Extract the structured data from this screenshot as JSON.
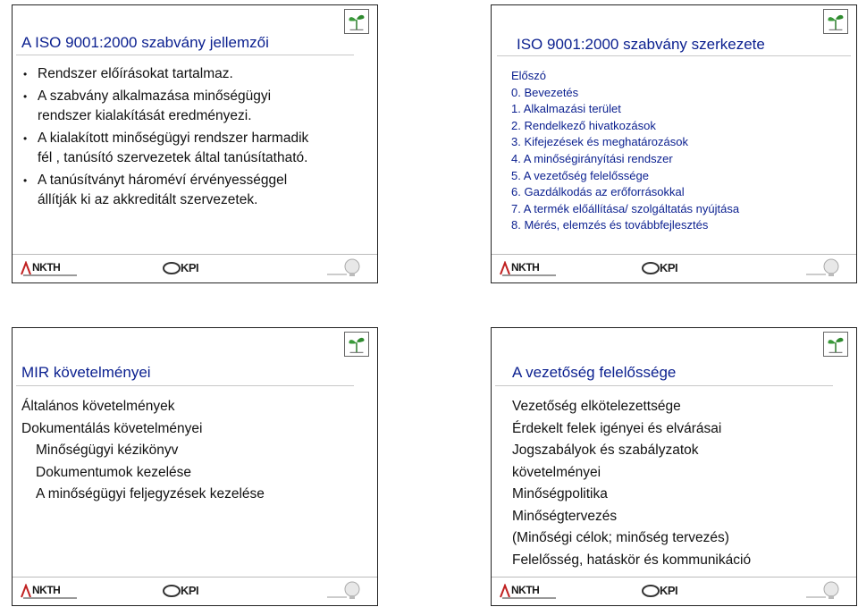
{
  "slides": [
    {
      "title": "A ISO 9001:2000 szabvány jellemzői",
      "items": [
        "Rendszer előírásokat tartalmaz.",
        "A szabvány alkalmazása minőségügyi rendszer kialakítását eredményezi.",
        "A kialakított minőségügyi rendszer harmadik fél , tanúsító szervezetek által tanúsítatható.",
        "A tanúsítványt hároméví érvényességgel állítják ki az akkreditált szervezetek."
      ]
    },
    {
      "title": "ISO 9001:2000 szabvány szerkezete",
      "items": [
        "Előszó",
        "0. Bevezetés",
        "1.  Alkalmazási terület",
        "2.  Rendelkező hivatkozások",
        "3.  Kifejezések és meghatározások",
        "4.  A minőségirányítási rendszer",
        "5.  A vezetőség felelőssége",
        "6.  Gazdálkodás az erőforrásokkal",
        "7.  A termék előállítása/ szolgáltatás nyújtása",
        "8.  Mérés, elemzés és továbbfejlesztés"
      ]
    },
    {
      "title": "MIR követelményei",
      "items": [
        {
          "text": "Általános követelmények",
          "indent": false
        },
        {
          "text": "Dokumentálás követelményei",
          "indent": false
        },
        {
          "text": "Minőségügyi kézikönyv",
          "indent": true
        },
        {
          "text": "Dokumentumok kezelése",
          "indent": true
        },
        {
          "text": "A minőségügyi feljegyzések kezelése",
          "indent": true
        }
      ]
    },
    {
      "title": "A vezetőség felelőssége",
      "items": [
        "Vezetőség elkötelezettsége",
        "Érdekelt felek igényei és elvárásai",
        "Jogszabályok és szabályzatok",
        "követelményei",
        "Minőségpolitika",
        "Minőségtervezés",
        "(Minőségi célok; minőség tervezés)",
        "Felelősség, hatáskör és kommunikáció"
      ]
    }
  ],
  "footer": {
    "nkth_label": "NKTH",
    "kpi_label": "KPI"
  },
  "colors": {
    "title_blue": "#0a1f8f",
    "text": "#111111"
  },
  "icons": [
    "sprout-icon",
    "nkth-logo",
    "kpi-logo",
    "lightbulb-logo"
  ]
}
